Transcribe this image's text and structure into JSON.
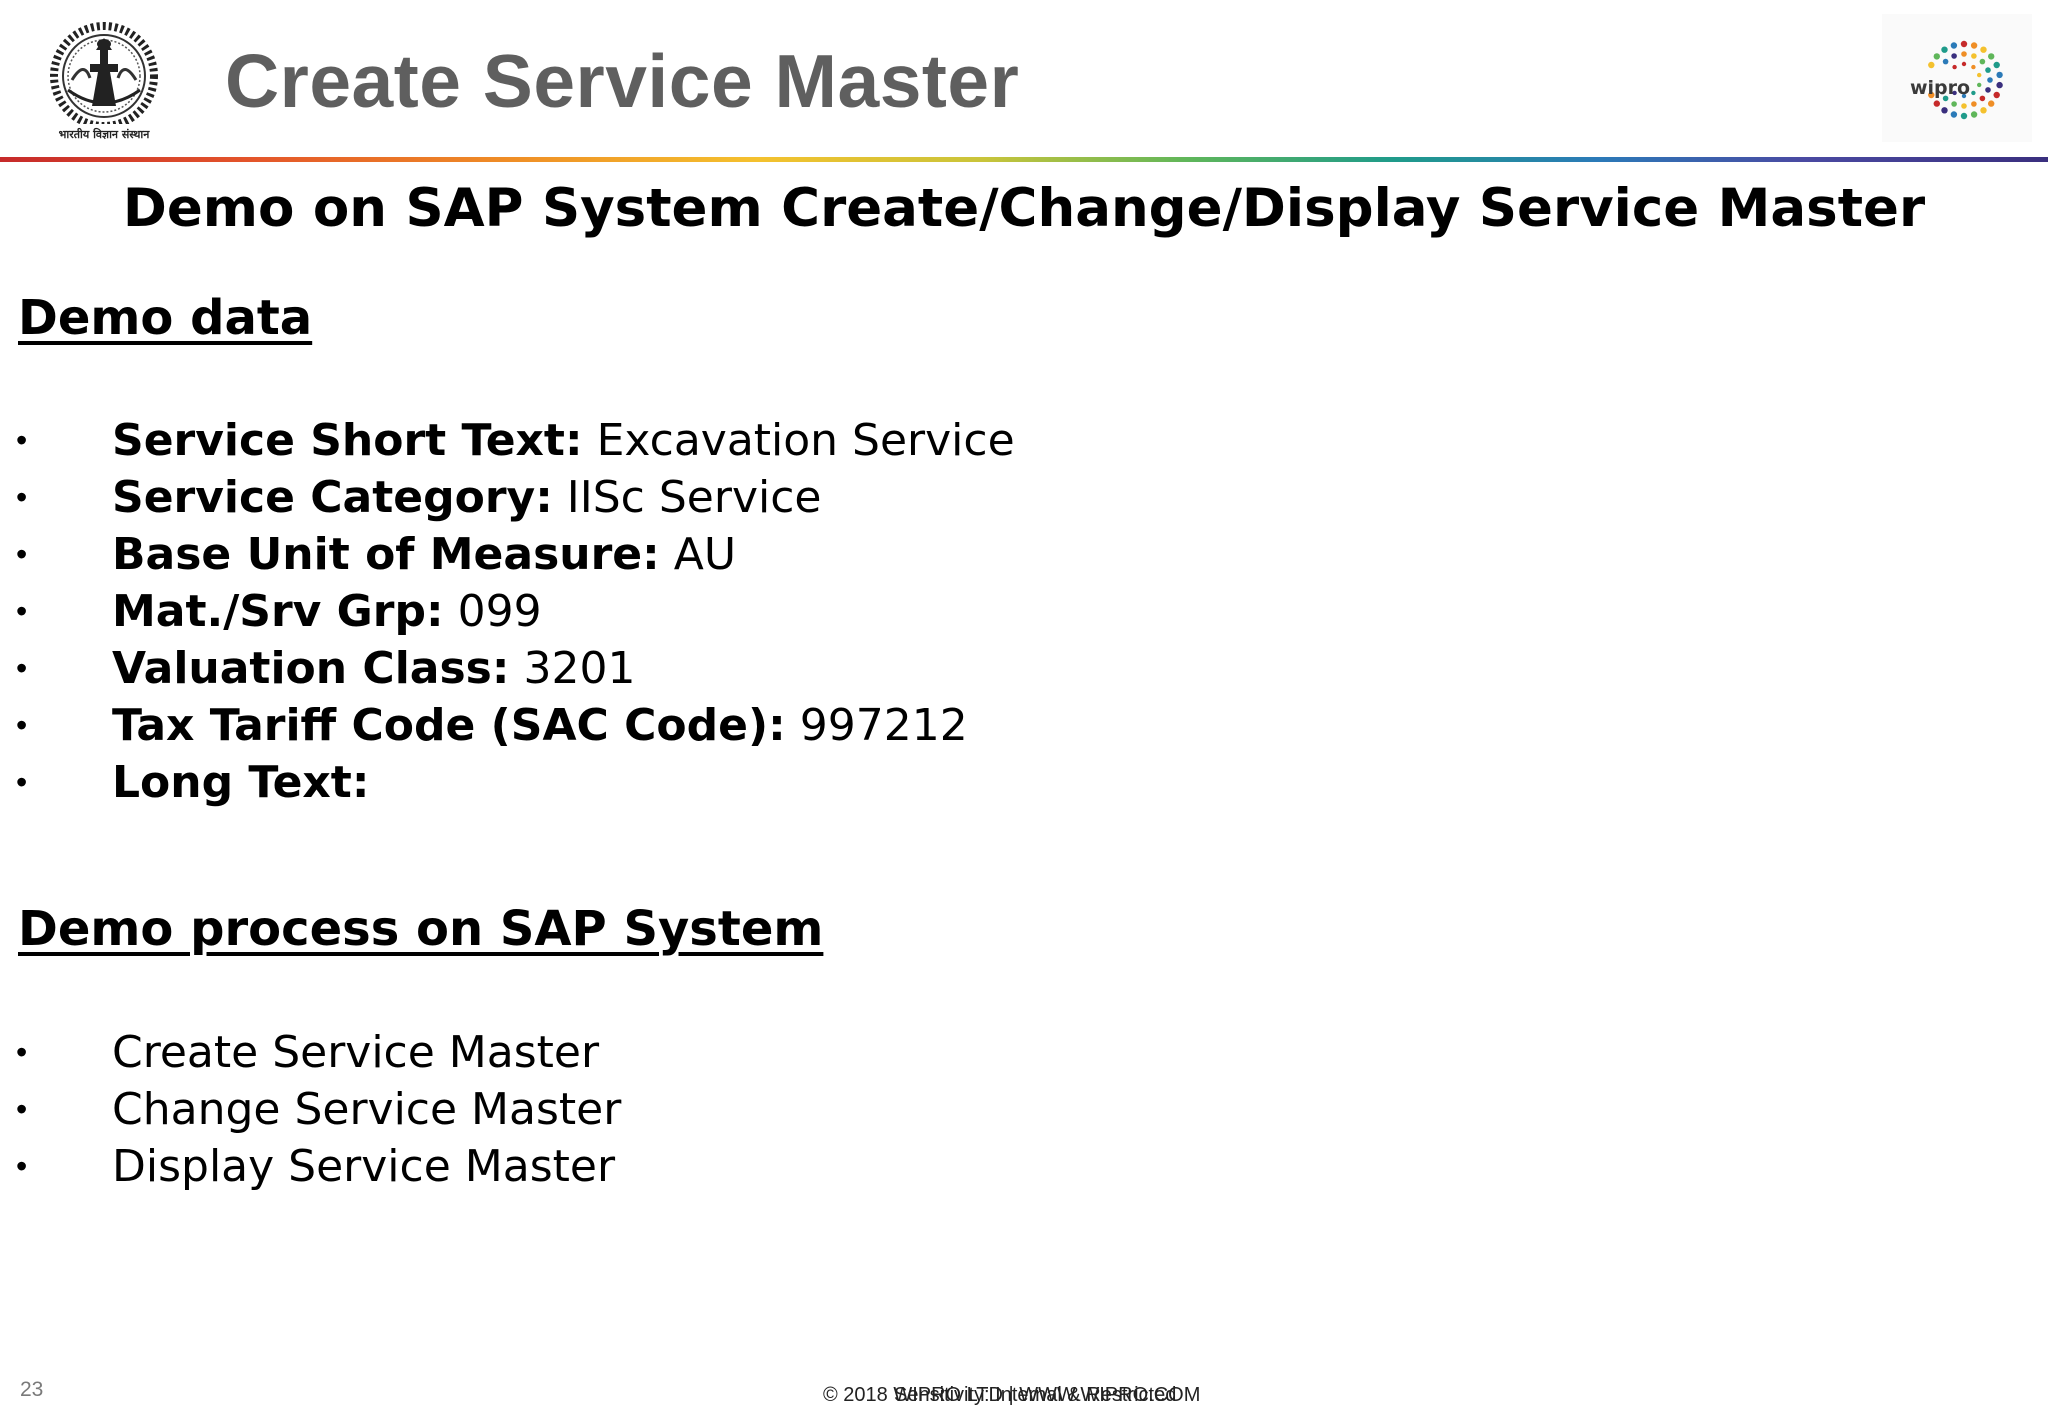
{
  "header": {
    "title": "Create Service Master",
    "left_logo": {
      "icon": "iisc-crest-icon",
      "caption": "भारतीय विज्ञान संस्थान"
    },
    "right_logo": {
      "icon": "wipro-logo-icon",
      "wordmark": "wipro"
    },
    "divider_colors": [
      "#c62a2a",
      "#ef8e26",
      "#f4c12e",
      "#5fb65a",
      "#1f9b8a",
      "#2b7ab8",
      "#3a2f7e"
    ]
  },
  "subtitle": "Demo on SAP System Create/Change/Display Service Master",
  "demo_data": {
    "heading": "Demo data",
    "items": [
      {
        "label": "Service Short Text:",
        "value": "Excavation Service"
      },
      {
        "label": "Service Category:",
        "value": "IISc Service"
      },
      {
        "label": "Base Unit of Measure:",
        "value": "AU"
      },
      {
        "label": "Mat./Srv Grp:",
        "value": "099"
      },
      {
        "label": "Valuation Class:",
        "value": "3201"
      },
      {
        "label": "Tax Tariff Code (SAC Code):",
        "value": "997212"
      },
      {
        "label": "Long Text:",
        "value": ""
      }
    ]
  },
  "demo_process": {
    "heading": "Demo process on SAP System",
    "items": [
      "Create Service Master",
      "Change Service Master",
      "Display Service Master"
    ]
  },
  "footer": {
    "page_number": "23",
    "copyright": "© 2018 WIPRO LTD | WWW.WIPRO.COM",
    "sensitivity": "Sensitivity: Internal & Restricted"
  }
}
